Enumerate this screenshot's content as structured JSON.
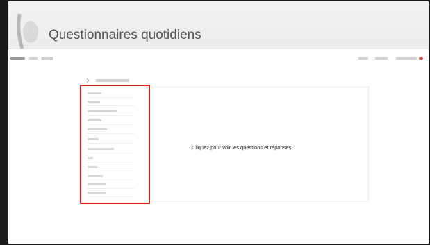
{
  "slide": {
    "title": "Questionnaires quotidiens"
  },
  "appbar": {
    "accent_color": "#d04a3a"
  },
  "sidebar": {
    "highlight_color": "#e02020",
    "item_count": 12
  },
  "main": {
    "message": "Cliquez pour voir les questions et réponses"
  }
}
